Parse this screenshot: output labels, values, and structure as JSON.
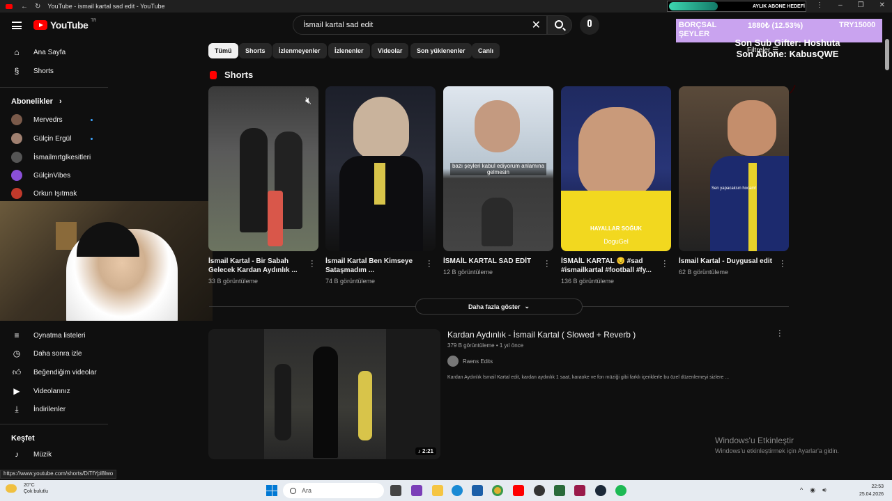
{
  "browser": {
    "tab_title": "YouTube - ismail kartal sad edit - YouTube",
    "widget_text": "AYLIK ABONE HEDEFİ"
  },
  "header": {
    "logo_text": "YouTube",
    "logo_sup": "TR",
    "search_value": "İsmail kartal sad edit"
  },
  "overlay": {
    "goal_name": "BORÇSAL ŞEYLER",
    "goal_amount": "1880₺ (12.53%)",
    "goal_target": "TRY15000",
    "sub_line1": "Son Sub Gifter: Hoshuta",
    "sub_line2": "Son Abone: KabusQWE",
    "filters_label": "Filtreler"
  },
  "sidebar": {
    "home": "Ana Sayfa",
    "shorts": "Shorts",
    "subscriptions_title": "Abonelikler",
    "subscriptions": [
      {
        "name": "Mervedrs",
        "color": "#7a5a4a"
      },
      {
        "name": "Gülçin Ergül",
        "color": "#a08070"
      },
      {
        "name": "İsmailmrtglkesitleri",
        "color": "#555555"
      },
      {
        "name": "GülçinVibes",
        "color": "#8a4fd8"
      },
      {
        "name": "Orkun Işıtmak",
        "color": "#c0392b"
      }
    ],
    "playlists": "Oynatma listeleri",
    "watch_later": "Daha sonra izle",
    "liked": "Beğendiğim videolar",
    "your_videos": "Videolarınız",
    "downloads": "İndirilenler",
    "explore_title": "Keşfet",
    "music": "Müzik"
  },
  "chips": [
    "Tümü",
    "Shorts",
    "İzlenmeyenler",
    "İzlenenler",
    "Videolar",
    "Son yüklenenler",
    "Canlı"
  ],
  "shorts_title": "Shorts",
  "shorts": [
    {
      "title": "İsmail Kartal - Bir Sabah Gelecek Kardan Aydınlık ...",
      "views": "33 B görüntüleme"
    },
    {
      "title": "İsmail Kartal Ben Kimseye Sataşmadım ...",
      "views": "74 B görüntüleme"
    },
    {
      "title": "İSMAİL KARTAL SAD EDİT",
      "views": "12 B görüntüleme",
      "caption": "bazı şeyleri kabul ediyorum anlamına gelmesin"
    },
    {
      "title": "İSMAİL KARTAL 😔 #sad #ismailkartal #football #fy...",
      "views": "136 B görüntüleme",
      "caption": "HAYALLAR SOĞUK",
      "caption2": "DoguGel"
    },
    {
      "title": "İsmail Kartal - Duygusal edit",
      "views": "62 B görüntüleme",
      "caption": "Sen yapacaksın hocam!"
    }
  ],
  "more_button": "Daha fazla göster",
  "video": {
    "title": "Kardan Aydınlık - İsmail Kartal ( Slowed + Reverb )",
    "meta": "379 B görüntüleme • 1 yıl önce",
    "channel": "Raens Edits",
    "description": "Kardan Aydınlık İsmail Kartal edit, kardan aydınlık 1 saat, karaoke ve fon müziği gibi farklı içeriklerle bu özel düzenlemeyi sizlere ...",
    "duration": "2:21"
  },
  "windows_activation": {
    "line1": "Windows'u Etkinleştir",
    "line2": "Windows'u etkinleştirmek için Ayarlar'a gidin."
  },
  "status_url": "https://www.youtube.com/shorts/DiTfYpl8lwo",
  "taskbar": {
    "temp": "20°C",
    "weather": "Çok bulutlu",
    "search_placeholder": "Ara",
    "time": "22:53",
    "date": "25.04.2026"
  }
}
